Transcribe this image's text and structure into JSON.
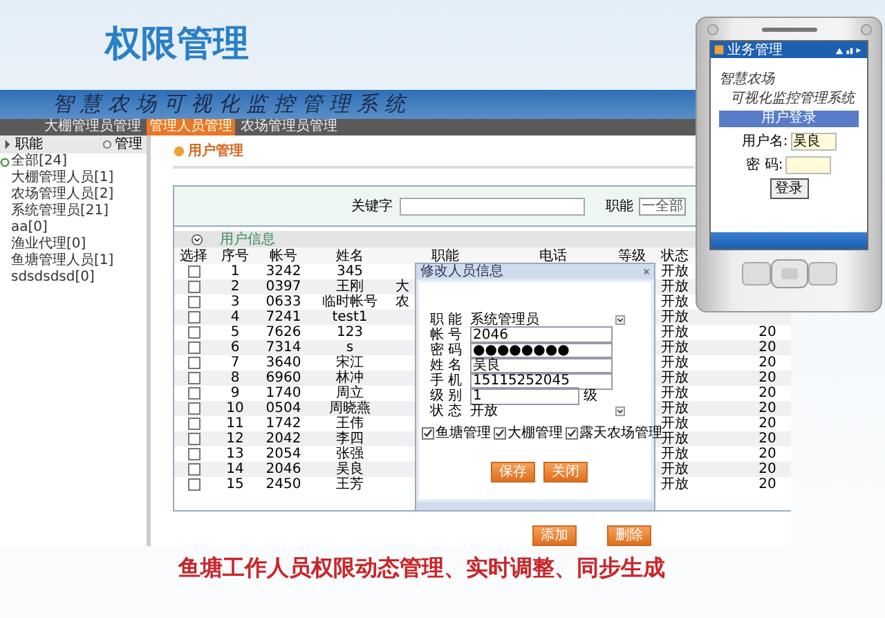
{
  "slide": {
    "title": "权限管理",
    "caption": "鱼塘工作人员权限动态管理、实时调整、同步生成"
  },
  "app": {
    "title": "智慧农场可视化监控管理系统",
    "nav": [
      {
        "label": "大棚管理员管理",
        "selected": false
      },
      {
        "label": "管理人员管理",
        "selected": true
      },
      {
        "label": "农场管理员管理",
        "selected": false
      }
    ],
    "sidebar": {
      "heading": "职能",
      "action": "管理",
      "tree": [
        {
          "label": "全部[24]",
          "expanded": true,
          "children": [
            {
              "label": "大棚管理人员[1]"
            },
            {
              "label": "农场管理人员[2]"
            },
            {
              "label": "系统管理员[21]"
            },
            {
              "label": "aa[0]"
            },
            {
              "label": "渔业代理[0]"
            },
            {
              "label": "鱼塘管理人员[1]"
            },
            {
              "label": "sdsdsdsd[0]"
            }
          ]
        }
      ]
    },
    "page_heading": "用户管理",
    "filter": {
      "keyword_label": "关键字",
      "role_label": "职能",
      "role_value": "一全部"
    },
    "section_title": "用户信息",
    "table": {
      "columns": [
        "选择",
        "序号",
        "帐号",
        "姓名",
        "职能",
        "电话",
        "等级",
        "状态"
      ],
      "rows": [
        {
          "checked": false,
          "number": "1",
          "account": "3242",
          "name": "345",
          "status": "开放"
        },
        {
          "checked": false,
          "number": "2",
          "account": "0397",
          "name": "王刚",
          "role": "大",
          "status": "开放"
        },
        {
          "checked": false,
          "number": "3",
          "account": "0633",
          "name": "临时帐号",
          "role": "农",
          "status": "开放"
        },
        {
          "checked": false,
          "number": "4",
          "account": "7241",
          "name": "test1",
          "status": "开放"
        },
        {
          "checked": false,
          "number": "5",
          "account": "7626",
          "name": "123",
          "status": "开放",
          "column_9": "20"
        },
        {
          "checked": false,
          "number": "6",
          "account": "7314",
          "name": "s",
          "status": "开放",
          "column_9": "20"
        },
        {
          "checked": false,
          "number": "7",
          "account": "3640",
          "name": "宋江",
          "status": "开放",
          "column_9": "20"
        },
        {
          "checked": false,
          "number": "8",
          "account": "6960",
          "name": "林冲",
          "status": "开放",
          "column_9": "20"
        },
        {
          "checked": false,
          "number": "9",
          "account": "1740",
          "name": "周立",
          "status": "开放",
          "column_9": "20"
        },
        {
          "checked": false,
          "number": "10",
          "account": "0504",
          "name": "周晓燕",
          "status": "开放",
          "column_9": "20"
        },
        {
          "checked": false,
          "number": "11",
          "account": "1742",
          "name": "王伟",
          "status": "开放",
          "column_9": "20"
        },
        {
          "checked": false,
          "number": "12",
          "account": "2042",
          "name": "李四",
          "status": "开放",
          "column_9": "20"
        },
        {
          "checked": false,
          "number": "13",
          "account": "2054",
          "name": "张强",
          "status": "开放",
          "column_9": "20"
        },
        {
          "checked": false,
          "number": "14",
          "account": "2046",
          "name": "吴良",
          "status": "开放",
          "column_9": "20"
        },
        {
          "checked": false,
          "number": "15",
          "account": "2450",
          "name": "王芳",
          "status": "开放",
          "column_9": "20"
        }
      ]
    },
    "actions": [
      "添加",
      "删除"
    ],
    "dialog": {
      "title": "修改人员信息",
      "fields": [
        {
          "label": "职 能",
          "value": "系统管理员",
          "kind": "select"
        },
        {
          "label": "帐 号",
          "value": "2046",
          "kind": "text"
        },
        {
          "label": "密 码",
          "value": "●●●●●●●●",
          "kind": "text"
        },
        {
          "label": "姓 名",
          "value": "吴良",
          "kind": "text"
        },
        {
          "label": "手 机",
          "value": "15115252045",
          "kind": "text"
        },
        {
          "label": "级 别",
          "value": "1",
          "suffix": "级",
          "kind": "text"
        },
        {
          "label": "状 态",
          "value": "开放",
          "kind": "select"
        }
      ],
      "permissions": [
        {
          "label": "鱼塘管理",
          "checked": true
        },
        {
          "label": "大棚管理",
          "checked": true
        },
        {
          "label": "露天农场管理",
          "checked": true
        }
      ],
      "buttons": [
        "保存",
        "关闭"
      ]
    }
  },
  "phone": {
    "status_title": "业务管理",
    "app_title_1": "智慧农场",
    "app_title_2": "可视化监控管理系统",
    "login_heading": "用户登录",
    "username_label": "用户名:",
    "username_value": "吴良",
    "password_label": "密 码:",
    "login_button": "登录"
  }
}
